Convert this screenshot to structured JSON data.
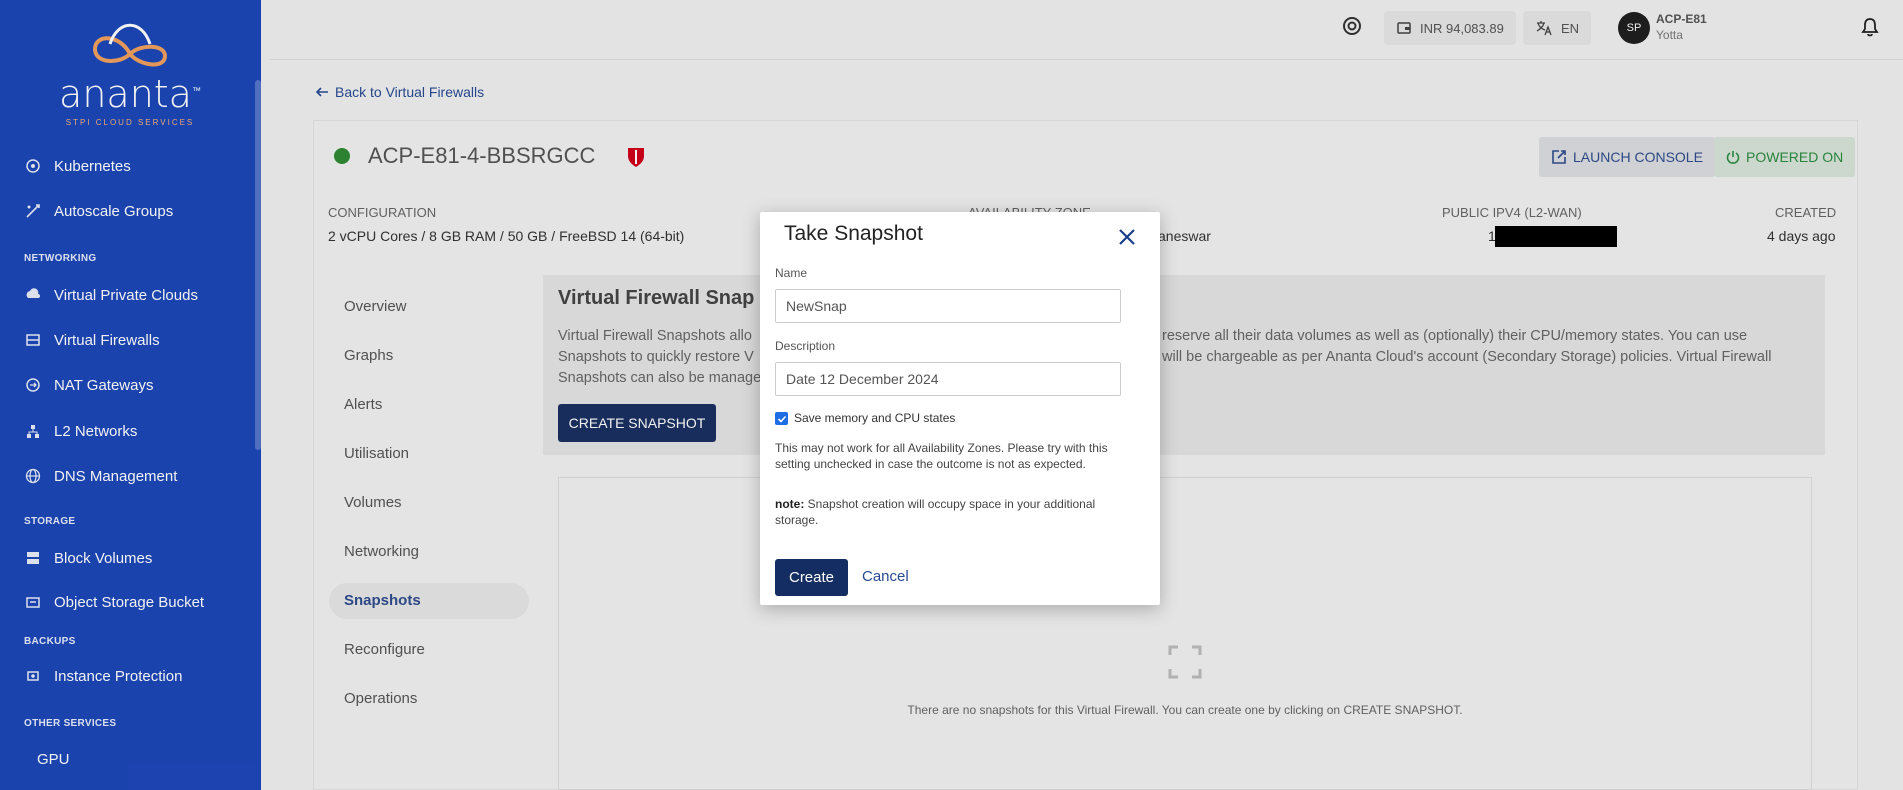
{
  "sidebar": {
    "logo": {
      "word": "ananta",
      "tm": "™",
      "sub": "STPI CLOUD SERVICES"
    },
    "items": [
      {
        "label": "Kubernetes",
        "icon": "kubernetes-icon"
      },
      {
        "label": "Autoscale Groups",
        "icon": "autoscale-icon"
      },
      {
        "label": "Virtual Private Clouds",
        "icon": "vpc-icon"
      },
      {
        "label": "Virtual Firewalls",
        "icon": "firewall-icon"
      },
      {
        "label": "NAT Gateways",
        "icon": "nat-icon"
      },
      {
        "label": "L2 Networks",
        "icon": "l2-network-icon"
      },
      {
        "label": "DNS Management",
        "icon": "globe-icon"
      },
      {
        "label": "Block Volumes",
        "icon": "block-volume-icon"
      },
      {
        "label": "Object Storage Bucket",
        "icon": "bucket-icon"
      },
      {
        "label": "Instance Protection",
        "icon": "protection-icon"
      },
      {
        "label": "GPU",
        "icon": ""
      }
    ],
    "sections": {
      "networking": "NETWORKING",
      "storage": "STORAGE",
      "backups": "BACKUPS",
      "other": "OTHER SERVICES"
    }
  },
  "topbar": {
    "balance": "INR 94,083.89",
    "language": "EN",
    "avatar": "SP",
    "user_name": "ACP-E81",
    "user_org": "Yotta"
  },
  "page": {
    "back": "Back to Virtual Firewalls",
    "title": "ACP-E81-4-BBSRGCC",
    "launch_console": "LAUNCH CONSOLE",
    "powered_on": "POWERED ON",
    "config_label": "CONFIGURATION",
    "config_value": "2 vCPU Cores / 8 GB RAM / 50 GB / FreeBSD 14 (64-bit)",
    "az_label": "AVAILABILITY ZONE",
    "az_value": "aneswar",
    "ip_label": "PUBLIC IPV4 (L2-WAN)",
    "ip_prefix": "1",
    "created_label": "CREATED",
    "created_value": "4 days ago"
  },
  "tabs": [
    "Overview",
    "Graphs",
    "Alerts",
    "Utilisation",
    "Volumes",
    "Networking",
    "Snapshots",
    "Reconfigure",
    "Operations"
  ],
  "panel": {
    "title": "Virtual Firewall Snap",
    "line1_left": "Virtual Firewall Snapshots allo",
    "line1_right": "reserve all their data volumes as well as (optionally) their CPU/memory states. You can use",
    "line2_left": "Snapshots to quickly restore V",
    "line2_right": "will be chargeable as per Ananta Cloud's account (Secondary Storage) policies. Virtual Firewall",
    "line3_left": "Snapshots can also be manage",
    "create_button": "CREATE SNAPSHOT",
    "empty_text": "There are no snapshots for this Virtual Firewall. You can create one by clicking on CREATE SNAPSHOT."
  },
  "modal": {
    "title": "Take Snapshot",
    "name_label": "Name",
    "name_value": "NewSnap",
    "description_label": "Description",
    "description_value": "Date 12 December 2024",
    "checkbox_label": "Save memory and CPU states",
    "note1": "This may not work for all Availability Zones. Please try with this setting unchecked in case the outcome is not as expected.",
    "note2_label": "note:",
    "note2_text": "Snapshot creation will occupy space in your additional storage.",
    "create": "Create",
    "cancel": "Cancel"
  }
}
